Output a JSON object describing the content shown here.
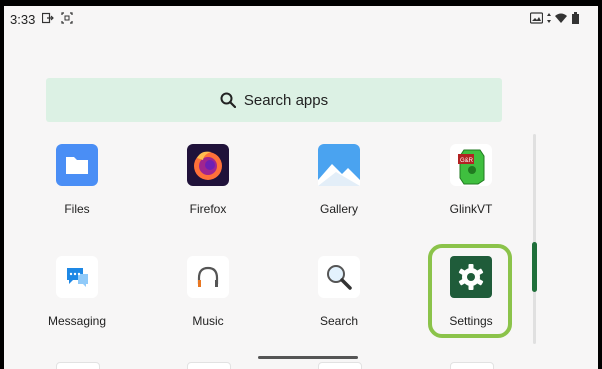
{
  "status_bar": {
    "time": "3:33"
  },
  "search": {
    "label": "Search apps"
  },
  "apps": [
    {
      "label": "Files",
      "icon": "files-icon"
    },
    {
      "label": "Firefox",
      "icon": "firefox-icon"
    },
    {
      "label": "Gallery",
      "icon": "gallery-icon"
    },
    {
      "label": "GlinkVT",
      "icon": "glinkvt-icon"
    },
    {
      "label": "Messaging",
      "icon": "messaging-icon"
    },
    {
      "label": "Music",
      "icon": "music-icon"
    },
    {
      "label": "Search",
      "icon": "search-app-icon"
    },
    {
      "label": "Settings",
      "icon": "settings-icon"
    }
  ],
  "colors": {
    "search_bg": "#dcf1e4",
    "highlight": "#8bc34a",
    "scroll_thumb": "#1f6f3a",
    "settings_tile": "#1f5c3a"
  }
}
